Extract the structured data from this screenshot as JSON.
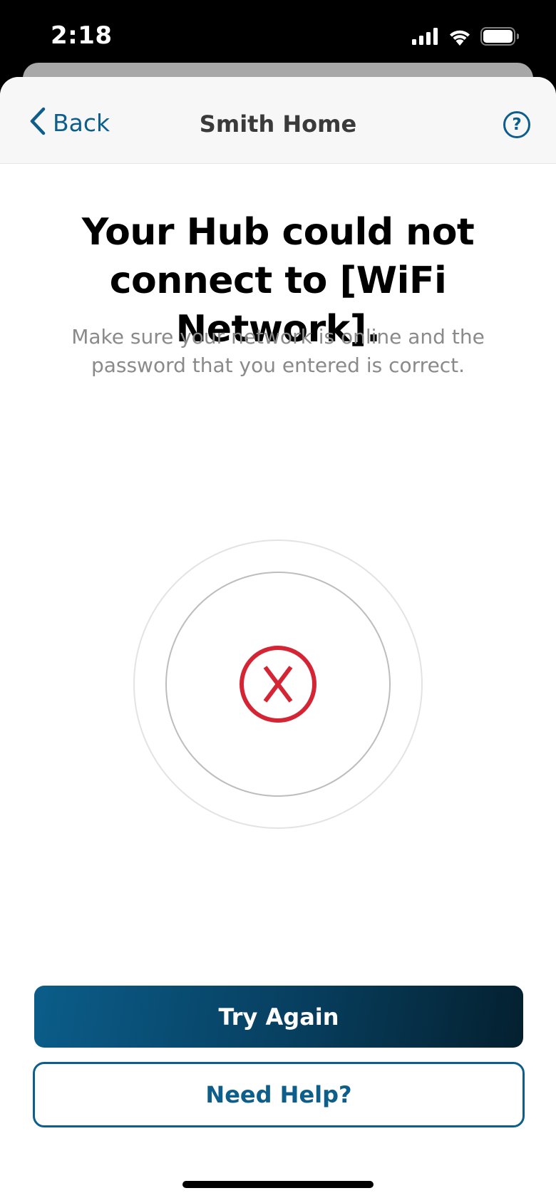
{
  "status_bar": {
    "time": "2:18",
    "signal_icon": "cellular-signal-icon",
    "wifi_icon": "wifi-icon",
    "battery_icon": "battery-icon"
  },
  "nav": {
    "back_label": "Back",
    "back_icon": "chevron-left-icon",
    "title": "Smith Home",
    "help_icon": "question-circle-icon",
    "help_glyph": "?"
  },
  "main": {
    "headline": "Your Hub could not connect to [WiFi Network].",
    "subtext": "Make sure your network is online and the password that you entered is correct.",
    "status_icon": "error-x-icon"
  },
  "actions": {
    "try_again_label": "Try Again",
    "need_help_label": "Need Help?"
  },
  "colors": {
    "accent": "#0d5e8b",
    "error": "#d52535",
    "primary_gradient_end": "#04202f"
  }
}
